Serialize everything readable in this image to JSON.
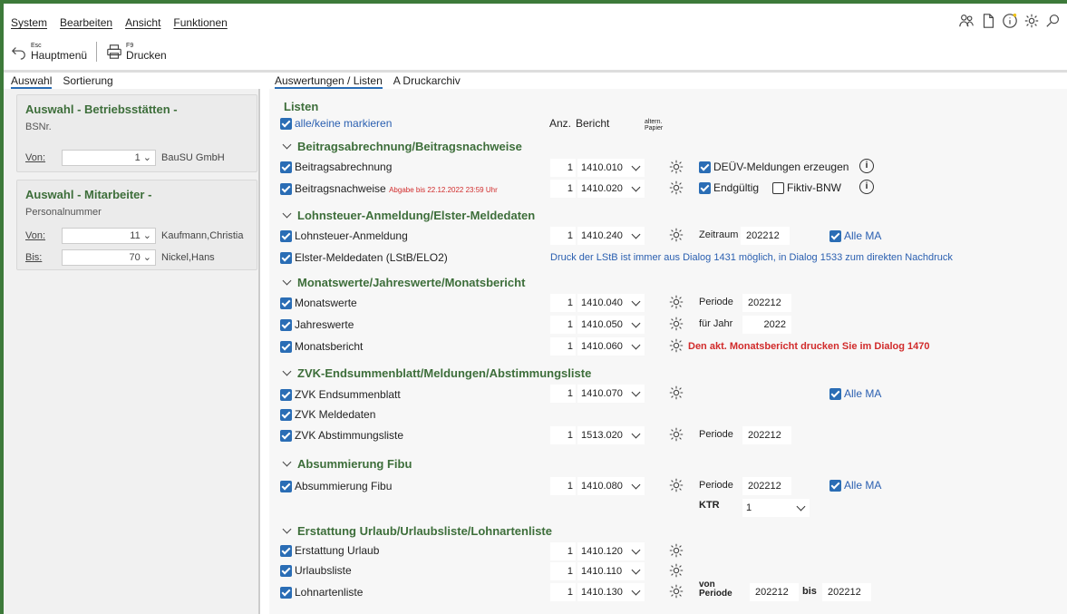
{
  "menu": {
    "system": "System",
    "bearbeiten": "Bearbeiten",
    "ansicht": "Ansicht",
    "funktionen": "Funktionen"
  },
  "toolbar": {
    "back_key": "Esc",
    "back_label": "Hauptmenü",
    "print_key": "F9",
    "print_label": "Drucken"
  },
  "left_tabs": {
    "auswahl": "Auswahl",
    "sortierung": "Sortierung"
  },
  "box1": {
    "title": "Auswahl - Betriebsstätten -",
    "sub": "BSNr.",
    "von_label": "Von:",
    "von_value": "1",
    "von_name": "BauSU GmbH"
  },
  "box2": {
    "title": "Auswahl - Mitarbeiter -",
    "sub": "Personalnummer",
    "von_label": "Von:",
    "von_value": "11",
    "von_name": "Kaufmann,Christia",
    "bis_label": "Bis:",
    "bis_value": "70",
    "bis_name": "Nickel,Hans"
  },
  "right_tabs": {
    "auswertungen": "Auswertungen / Listen",
    "druckarchiv": "A Druckarchiv"
  },
  "listen": {
    "title": "Listen",
    "all": "alle/keine markieren",
    "anz": "Anz.",
    "bericht": "Bericht",
    "altern": "altern.",
    "papier": "Papier"
  },
  "sections": {
    "s1": "Beitragsabrechnung/Beitragsnachweise",
    "s2": "Lohnsteuer-Anmeldung/Elster-Meldedaten",
    "s3": "Monatswerte/Jahreswerte/Monatsbericht",
    "s4": "ZVK-Endsummenblatt/Meldungen/Abstimmungsliste",
    "s5": "Absummierung Fibu",
    "s6": "Erstattung Urlaub/Urlaubsliste/Lohnartenliste"
  },
  "rows": {
    "r1": {
      "label": "Beitragsabrechnung",
      "anz": "1",
      "bericht": "1410.010"
    },
    "r2": {
      "label": "Beitragsnachweise",
      "note": "Abgabe bis 22.12.2022 23:59 Uhr",
      "anz": "1",
      "bericht": "1410.020"
    },
    "r3": {
      "label": "Lohnsteuer-Anmeldung",
      "anz": "1",
      "bericht": "1410.240"
    },
    "r4": {
      "label": "Elster-Meldedaten (LStB/ELO2)"
    },
    "r5": {
      "label": "Monatswerte",
      "anz": "1",
      "bericht": "1410.040"
    },
    "r6": {
      "label": "Jahreswerte",
      "anz": "1",
      "bericht": "1410.050"
    },
    "r7": {
      "label": "Monatsbericht",
      "anz": "1",
      "bericht": "1410.060"
    },
    "r8": {
      "label": "ZVK Endsummenblatt",
      "anz": "1",
      "bericht": "1410.070"
    },
    "r9": {
      "label": "ZVK Meldedaten"
    },
    "r10": {
      "label": "ZVK Abstimmungsliste",
      "anz": "1",
      "bericht": "1513.020"
    },
    "r11": {
      "label": "Absummierung Fibu",
      "anz": "1",
      "bericht": "1410.080"
    },
    "r12": {
      "label": "Erstattung Urlaub",
      "anz": "1",
      "bericht": "1410.120"
    },
    "r13": {
      "label": "Urlaubsliste",
      "anz": "1",
      "bericht": "1410.110"
    },
    "r14": {
      "label": "Lohnartenliste",
      "anz": "1",
      "bericht": "1410.130"
    }
  },
  "extras": {
    "deuev": "DEÜV-Meldungen erzeugen",
    "endgueltig": "Endgültig",
    "fiktiv": "Fiktiv-BNW",
    "zeitraum": "Zeitraum",
    "zeitraum_val": "202212",
    "alle_ma": "Alle MA",
    "elster_info": "Druck der LStB ist immer aus Dialog 1431 möglich, in Dialog 1533 zum direkten Nachdruck",
    "periode": "Periode",
    "periode_val": "202212",
    "fuer_jahr": "für Jahr",
    "jahr_val": "2022",
    "monatsbericht_hint": "Den akt. Monatsbericht drucken Sie im Dialog 1470",
    "ktr": "KTR",
    "ktr_val": "1",
    "von": "von",
    "periode2": "Periode",
    "bis": "bis",
    "bis_val": "202212"
  }
}
